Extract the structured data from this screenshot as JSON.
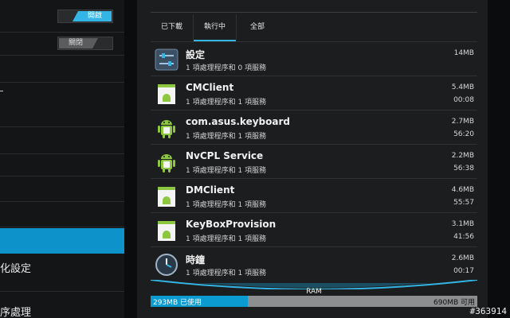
{
  "left_pane": {
    "rows": [
      {
        "label": "",
        "toggle": "開啟"
      },
      {
        "label": "",
        "toggle": "關閉"
      },
      {
        "label": ""
      },
      {
        "label": ""
      },
      {
        "label": ""
      },
      {
        "label": ""
      },
      {
        "label": ""
      },
      {
        "label": "",
        "selected": true
      },
      {
        "label": "化設定"
      },
      {
        "label": "序處理"
      }
    ]
  },
  "tabs": [
    {
      "label": "已下載",
      "selected": false
    },
    {
      "label": "執行中",
      "selected": true
    },
    {
      "label": "全部",
      "selected": false
    }
  ],
  "apps": [
    {
      "name": "設定",
      "sub": "1 項處理程序和 0 項服務",
      "size": "14MB",
      "time": "",
      "icon": "settings-icon"
    },
    {
      "name": "CMClient",
      "sub": "1 項處理程序和 1 項服務",
      "size": "5.4MB",
      "time": "00:08",
      "icon": "android-app-icon"
    },
    {
      "name": "com.asus.keyboard",
      "sub": "1 項處理程序和 1 項服務",
      "size": "2.7MB",
      "time": "56:20",
      "icon": "android-robot-icon"
    },
    {
      "name": "NvCPL Service",
      "sub": "1 項處理程序和 1 項服務",
      "size": "2.2MB",
      "time": "56:38",
      "icon": "android-robot-icon"
    },
    {
      "name": "DMClient",
      "sub": "1 項處理程序和 1 項服務",
      "size": "4.6MB",
      "time": "55:57",
      "icon": "android-app-icon"
    },
    {
      "name": "KeyBoxProvision",
      "sub": "1 項處理程序和 1 項服務",
      "size": "3.1MB",
      "time": "41:56",
      "icon": "android-app-icon"
    },
    {
      "name": "時鐘",
      "sub": "1 項處理程序和 1 項服務",
      "size": "2.6MB",
      "time": "00:17",
      "icon": "clock-icon"
    }
  ],
  "ram": {
    "label": "RAM",
    "used": "293MB 已使用",
    "free": "690MB 可用",
    "used_fraction": 0.298
  },
  "watermark": "#363914",
  "colors": {
    "accent": "#33b5e5",
    "selected_row": "#0d93c9",
    "android_green": "#8dc63f"
  }
}
